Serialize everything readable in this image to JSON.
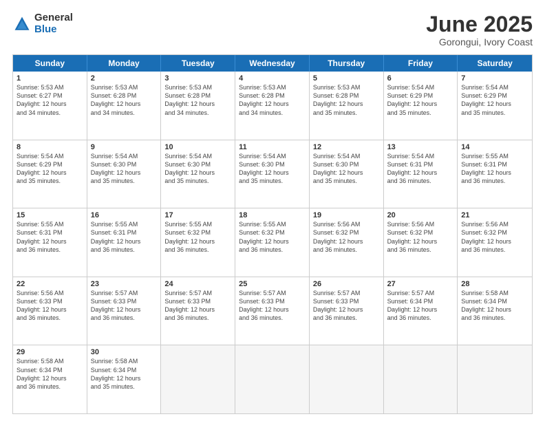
{
  "logo": {
    "general": "General",
    "blue": "Blue"
  },
  "title": "June 2025",
  "location": "Gorongui, Ivory Coast",
  "days": [
    "Sunday",
    "Monday",
    "Tuesday",
    "Wednesday",
    "Thursday",
    "Friday",
    "Saturday"
  ],
  "rows": [
    [
      {
        "day": "",
        "info": ""
      },
      {
        "day": "2",
        "info": "Sunrise: 5:53 AM\nSunset: 6:28 PM\nDaylight: 12 hours\nand 34 minutes."
      },
      {
        "day": "3",
        "info": "Sunrise: 5:53 AM\nSunset: 6:28 PM\nDaylight: 12 hours\nand 34 minutes."
      },
      {
        "day": "4",
        "info": "Sunrise: 5:53 AM\nSunset: 6:28 PM\nDaylight: 12 hours\nand 34 minutes."
      },
      {
        "day": "5",
        "info": "Sunrise: 5:53 AM\nSunset: 6:28 PM\nDaylight: 12 hours\nand 35 minutes."
      },
      {
        "day": "6",
        "info": "Sunrise: 5:54 AM\nSunset: 6:29 PM\nDaylight: 12 hours\nand 35 minutes."
      },
      {
        "day": "7",
        "info": "Sunrise: 5:54 AM\nSunset: 6:29 PM\nDaylight: 12 hours\nand 35 minutes."
      }
    ],
    [
      {
        "day": "1",
        "info": "Sunrise: 5:53 AM\nSunset: 6:27 PM\nDaylight: 12 hours\nand 34 minutes."
      },
      {
        "day": "9",
        "info": "Sunrise: 5:54 AM\nSunset: 6:30 PM\nDaylight: 12 hours\nand 35 minutes."
      },
      {
        "day": "10",
        "info": "Sunrise: 5:54 AM\nSunset: 6:30 PM\nDaylight: 12 hours\nand 35 minutes."
      },
      {
        "day": "11",
        "info": "Sunrise: 5:54 AM\nSunset: 6:30 PM\nDaylight: 12 hours\nand 35 minutes."
      },
      {
        "day": "12",
        "info": "Sunrise: 5:54 AM\nSunset: 6:30 PM\nDaylight: 12 hours\nand 35 minutes."
      },
      {
        "day": "13",
        "info": "Sunrise: 5:54 AM\nSunset: 6:31 PM\nDaylight: 12 hours\nand 36 minutes."
      },
      {
        "day": "14",
        "info": "Sunrise: 5:55 AM\nSunset: 6:31 PM\nDaylight: 12 hours\nand 36 minutes."
      }
    ],
    [
      {
        "day": "8",
        "info": "Sunrise: 5:54 AM\nSunset: 6:29 PM\nDaylight: 12 hours\nand 35 minutes."
      },
      {
        "day": "16",
        "info": "Sunrise: 5:55 AM\nSunset: 6:31 PM\nDaylight: 12 hours\nand 36 minutes."
      },
      {
        "day": "17",
        "info": "Sunrise: 5:55 AM\nSunset: 6:32 PM\nDaylight: 12 hours\nand 36 minutes."
      },
      {
        "day": "18",
        "info": "Sunrise: 5:55 AM\nSunset: 6:32 PM\nDaylight: 12 hours\nand 36 minutes."
      },
      {
        "day": "19",
        "info": "Sunrise: 5:56 AM\nSunset: 6:32 PM\nDaylight: 12 hours\nand 36 minutes."
      },
      {
        "day": "20",
        "info": "Sunrise: 5:56 AM\nSunset: 6:32 PM\nDaylight: 12 hours\nand 36 minutes."
      },
      {
        "day": "21",
        "info": "Sunrise: 5:56 AM\nSunset: 6:32 PM\nDaylight: 12 hours\nand 36 minutes."
      }
    ],
    [
      {
        "day": "15",
        "info": "Sunrise: 5:55 AM\nSunset: 6:31 PM\nDaylight: 12 hours\nand 36 minutes."
      },
      {
        "day": "23",
        "info": "Sunrise: 5:57 AM\nSunset: 6:33 PM\nDaylight: 12 hours\nand 36 minutes."
      },
      {
        "day": "24",
        "info": "Sunrise: 5:57 AM\nSunset: 6:33 PM\nDaylight: 12 hours\nand 36 minutes."
      },
      {
        "day": "25",
        "info": "Sunrise: 5:57 AM\nSunset: 6:33 PM\nDaylight: 12 hours\nand 36 minutes."
      },
      {
        "day": "26",
        "info": "Sunrise: 5:57 AM\nSunset: 6:33 PM\nDaylight: 12 hours\nand 36 minutes."
      },
      {
        "day": "27",
        "info": "Sunrise: 5:57 AM\nSunset: 6:34 PM\nDaylight: 12 hours\nand 36 minutes."
      },
      {
        "day": "28",
        "info": "Sunrise: 5:58 AM\nSunset: 6:34 PM\nDaylight: 12 hours\nand 36 minutes."
      }
    ],
    [
      {
        "day": "22",
        "info": "Sunrise: 5:56 AM\nSunset: 6:33 PM\nDaylight: 12 hours\nand 36 minutes."
      },
      {
        "day": "30",
        "info": "Sunrise: 5:58 AM\nSunset: 6:34 PM\nDaylight: 12 hours\nand 35 minutes."
      },
      {
        "day": "",
        "info": ""
      },
      {
        "day": "",
        "info": ""
      },
      {
        "day": "",
        "info": ""
      },
      {
        "day": "",
        "info": ""
      },
      {
        "day": "",
        "info": ""
      }
    ],
    [
      {
        "day": "29",
        "info": "Sunrise: 5:58 AM\nSunset: 6:34 PM\nDaylight: 12 hours\nand 36 minutes."
      },
      {
        "day": "",
        "info": ""
      },
      {
        "day": "",
        "info": ""
      },
      {
        "day": "",
        "info": ""
      },
      {
        "day": "",
        "info": ""
      },
      {
        "day": "",
        "info": ""
      },
      {
        "day": "",
        "info": ""
      }
    ]
  ]
}
